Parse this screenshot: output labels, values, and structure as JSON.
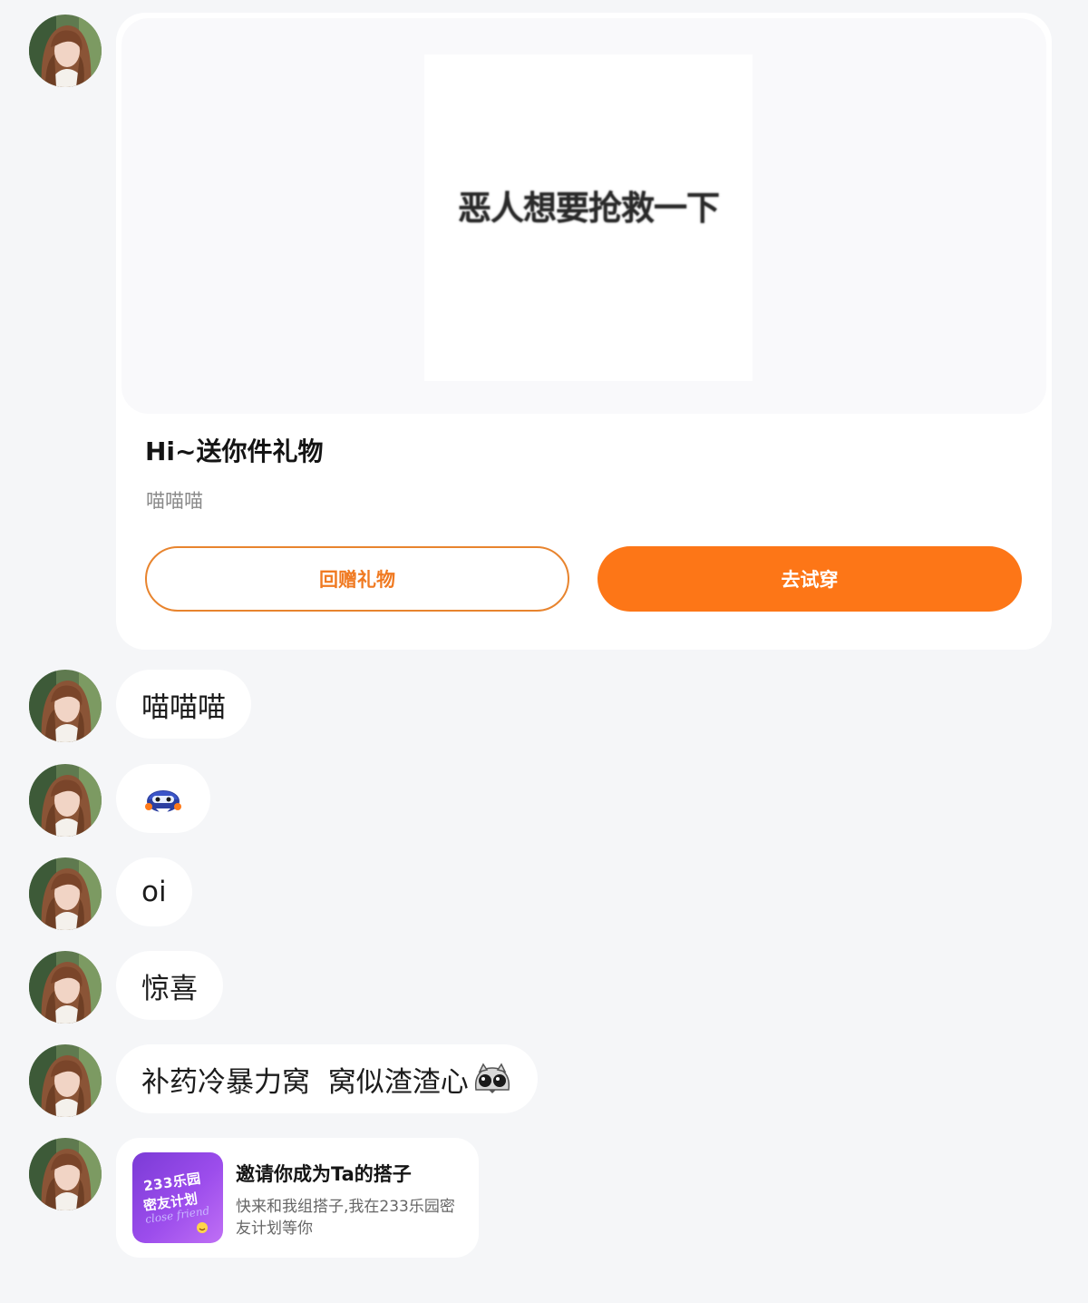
{
  "gift": {
    "image_text": "恶人想要抢救一下",
    "title": "Hi~送你件礼物",
    "subtitle": "喵喵喵",
    "return_button": "回赠礼物",
    "try_button": "去试穿"
  },
  "messages": [
    {
      "type": "text",
      "text": "喵喵喵"
    },
    {
      "type": "sticker",
      "icon": "robot-sticker-icon"
    },
    {
      "type": "text",
      "text": "oi"
    },
    {
      "type": "text",
      "text": "惊喜"
    },
    {
      "type": "text",
      "text": "补药冷暴力窝  窝似渣渣心",
      "trailing_icon": "cat-eyes-emoji-icon"
    }
  ],
  "invite": {
    "thumb_brand": "233乐园",
    "thumb_plan": "密友计划",
    "thumb_script": "close friend",
    "title": "邀请你成为Ta的搭子",
    "description": "快来和我组搭子,我在233乐园密友计划等你"
  },
  "colors": {
    "accent": "#fd7617",
    "outline": "#e8842e",
    "background": "#f5f6f8"
  }
}
